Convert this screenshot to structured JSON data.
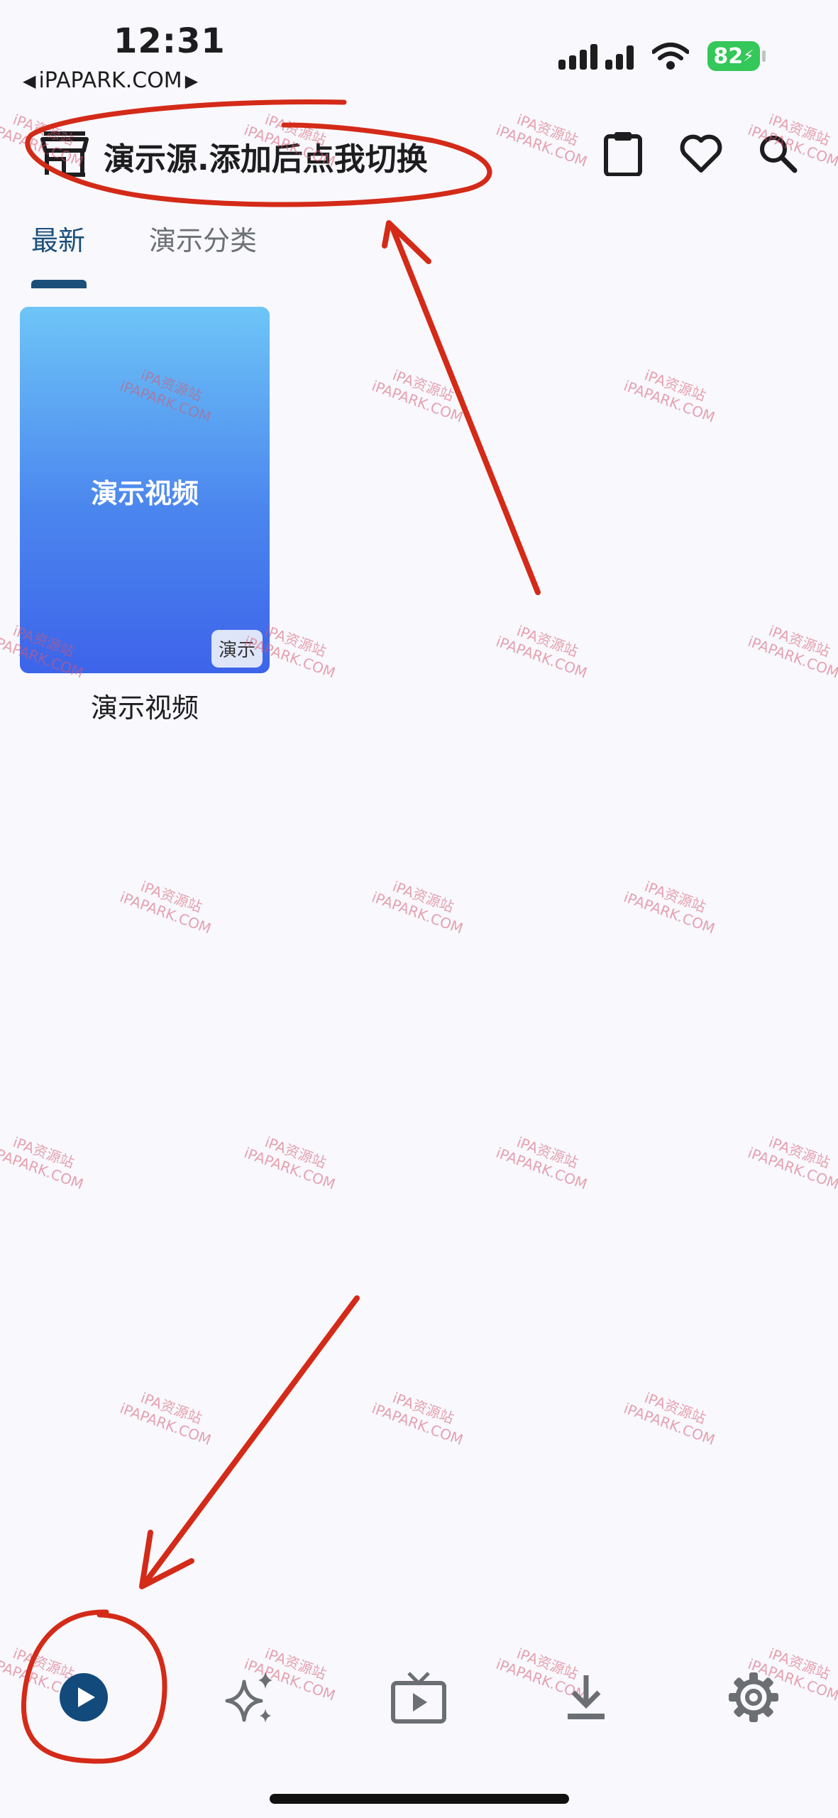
{
  "status_bar": {
    "time": "12:31",
    "back_app": "iPAPARK.COM",
    "battery": "82"
  },
  "header": {
    "title": "演示源.添加后点我切换",
    "icons": [
      "store-icon",
      "clipboard-icon",
      "heart-icon",
      "search-icon"
    ]
  },
  "tabs": [
    {
      "label": "最新",
      "active": true
    },
    {
      "label": "演示分类",
      "active": false
    }
  ],
  "card": {
    "cover_text": "演示视频",
    "badge": "演示",
    "title": "演示视频",
    "colors": [
      "#6ec5f7",
      "#3d64ea"
    ]
  },
  "watermark": {
    "line1": "iPA资源站",
    "line2": "iPAPARK.COM"
  },
  "bottom_nav": [
    "play-circle-icon",
    "sparkle-icon",
    "tv-icon",
    "download-icon",
    "gear-icon"
  ],
  "colors": {
    "accent": "#1b4f7a",
    "annotation": "#d42a18",
    "background": "#f8f8fd"
  }
}
